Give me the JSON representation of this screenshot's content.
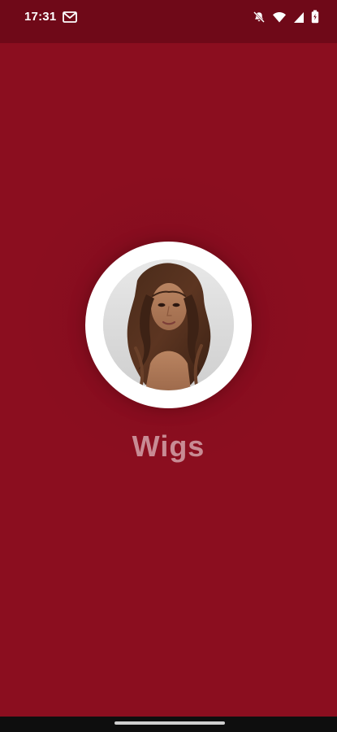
{
  "status_bar": {
    "time": "17:31",
    "icons": [
      "gmail-icon",
      "dnd-bell-off-icon",
      "wifi-icon",
      "signal-icon",
      "battery-icon"
    ]
  },
  "splash": {
    "app_name": "Wigs",
    "logo_image": "woman-with-long-brown-wavy-wig"
  },
  "colors": {
    "status_bar_bg": "#6f0918",
    "splash_bg": "#8b0e1f",
    "app_name_text": "#c88b94",
    "logo_ring": "#ffffff"
  }
}
